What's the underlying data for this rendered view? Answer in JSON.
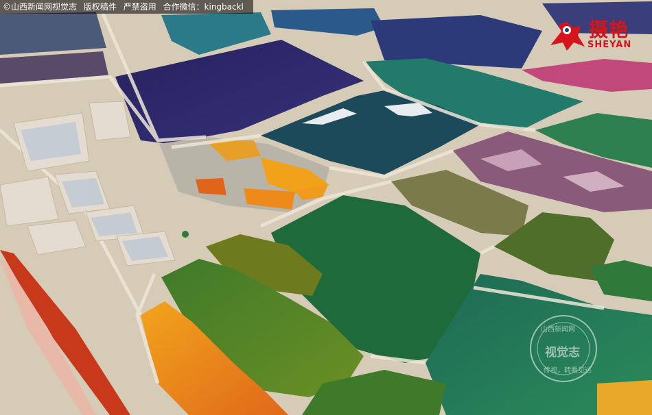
{
  "caption": {
    "copyright_text": "©山西新闻网视觉志",
    "rights_text": "版权稿件",
    "warning_text": "严禁盗用",
    "contact_text": "合作微信：kingbackl"
  },
  "brand": {
    "logo_cn": "摄艳",
    "logo_en": "SHEYAN",
    "color": "#d7131c"
  },
  "watermark": {
    "top_text": "山西新闻网",
    "center_text": "视觉志",
    "bottom_text": "传视，转看见达"
  },
  "scene": {
    "description_icon": "aerial-salt-lake-ponds",
    "palette": [
      "#2a2a6e",
      "#1f5a6a",
      "#2f7a4a",
      "#6e8a2a",
      "#e8871a",
      "#b85a7a",
      "#2f8a8a",
      "#d9d2c4"
    ]
  }
}
